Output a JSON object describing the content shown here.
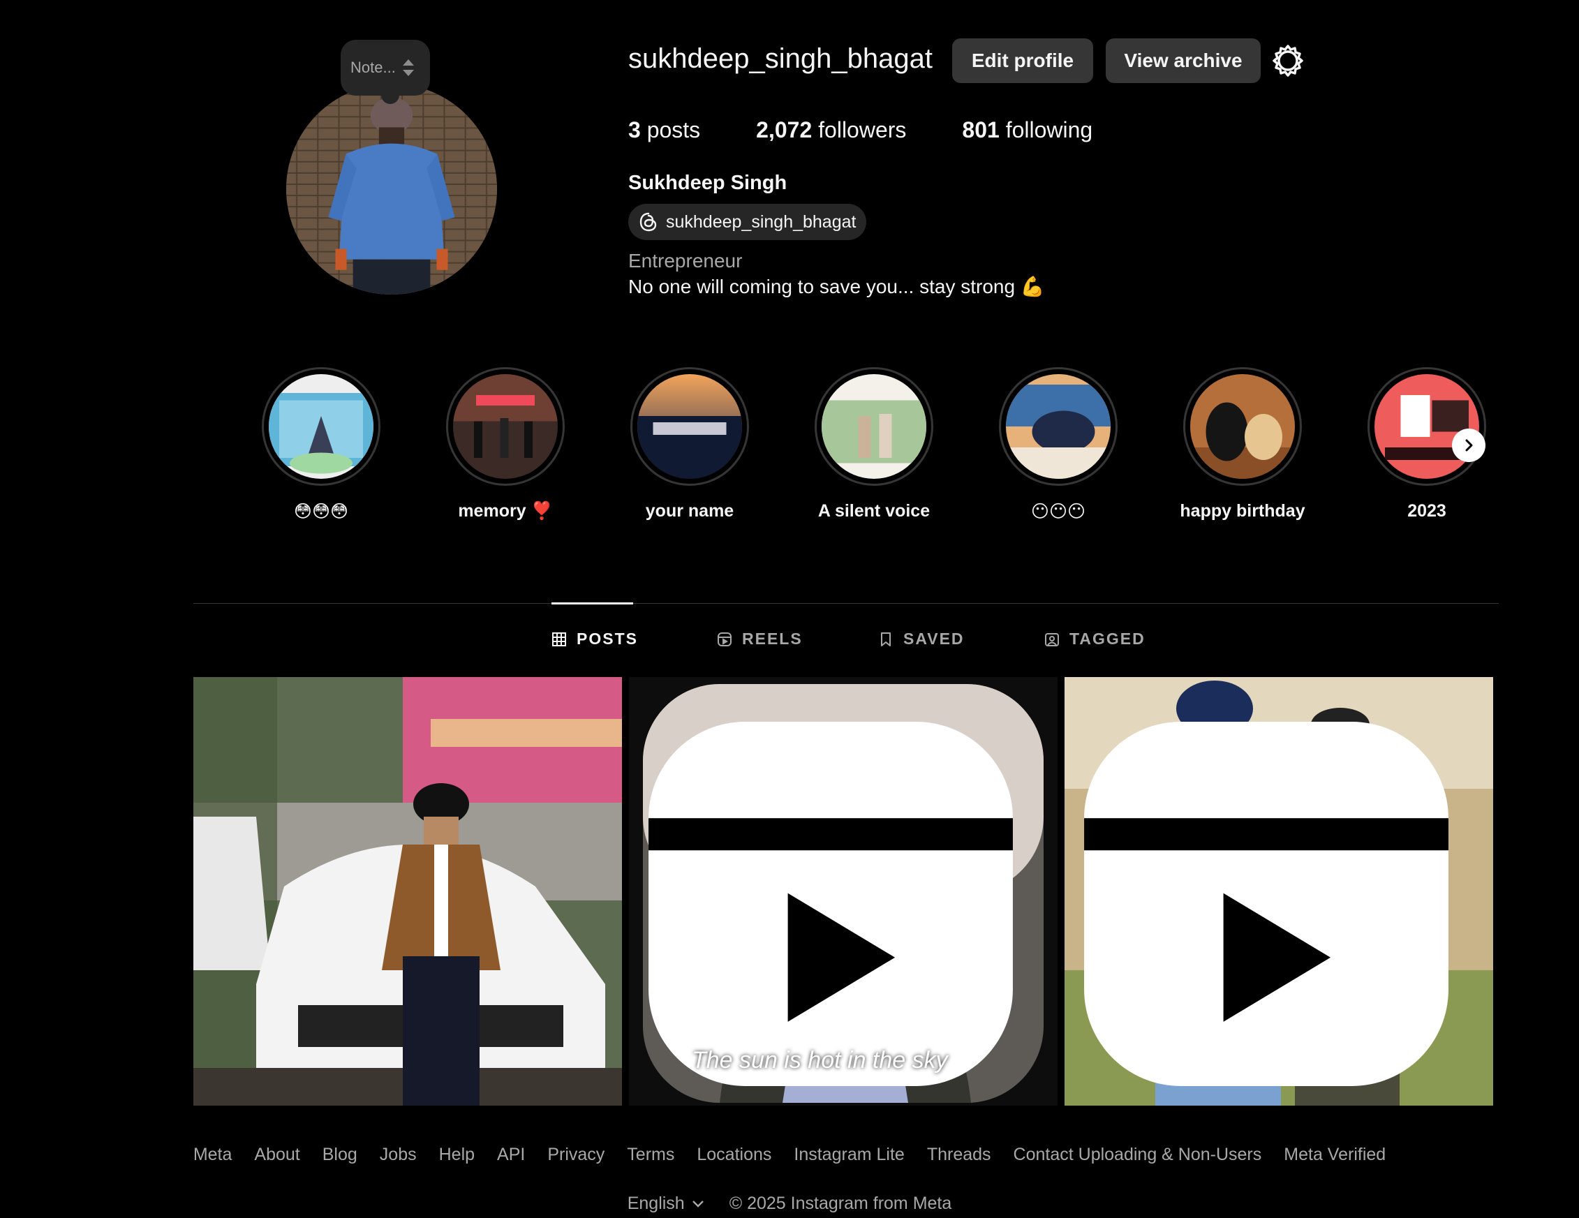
{
  "note": {
    "placeholder": "Note..."
  },
  "profile": {
    "username": "sukhdeep_singh_bhagat",
    "edit_label": "Edit profile",
    "archive_label": "View archive",
    "posts_count": "3",
    "posts_label": "posts",
    "followers_count": "2,072",
    "followers_label": "followers",
    "following_count": "801",
    "following_label": "following",
    "full_name": "Sukhdeep Singh",
    "threads_handle": "sukhdeep_singh_bhagat",
    "category": "Entrepreneur",
    "bio": "No one will coming to save you... stay strong 💪"
  },
  "highlights": [
    {
      "label": "😳😳😳"
    },
    {
      "label": "memory ❣️"
    },
    {
      "label": "your name"
    },
    {
      "label": "A silent voice"
    },
    {
      "label": "😶😶😶"
    },
    {
      "label": "happy birthday"
    },
    {
      "label": "2023"
    }
  ],
  "tabs": [
    {
      "label": "POSTS",
      "icon": "grid-icon",
      "active": true
    },
    {
      "label": "REELS",
      "icon": "reels-icon"
    },
    {
      "label": "SAVED",
      "icon": "bookmark-icon"
    },
    {
      "label": "TAGGED",
      "icon": "tagged-icon"
    }
  ],
  "posts": [
    {
      "type": "photo"
    },
    {
      "type": "reel",
      "caption": "The sun is hot in the sky"
    },
    {
      "type": "reel"
    }
  ],
  "footer": {
    "links": [
      "Meta",
      "About",
      "Blog",
      "Jobs",
      "Help",
      "API",
      "Privacy",
      "Terms",
      "Locations",
      "Instagram Lite",
      "Threads",
      "Contact Uploading & Non-Users",
      "Meta Verified"
    ],
    "language": "English",
    "copyright": "© 2025 Instagram from Meta"
  }
}
